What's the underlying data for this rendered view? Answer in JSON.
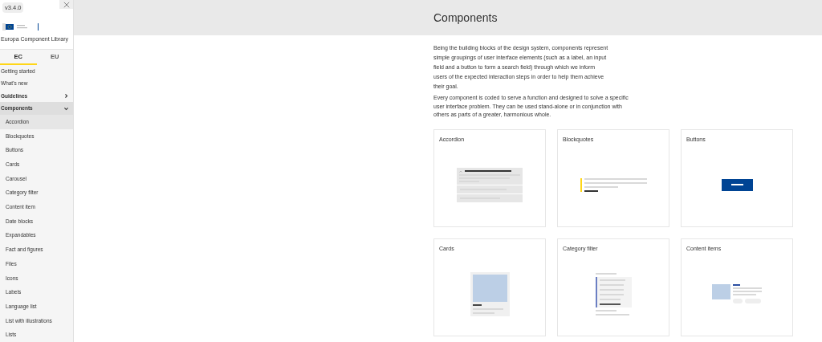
{
  "sidebar": {
    "version": "v3.4.0",
    "library_name": "Europa Component Library",
    "tabs": [
      {
        "label": "EC",
        "selected": true
      },
      {
        "label": "EU",
        "selected": false
      }
    ],
    "items": [
      {
        "label": "Getting started",
        "kind": "link"
      },
      {
        "label": "What's new",
        "kind": "link"
      },
      {
        "label": "Guidelines",
        "kind": "section",
        "expanded": false,
        "selected": false
      },
      {
        "label": "Components",
        "kind": "section",
        "expanded": true,
        "selected": true,
        "children": [
          {
            "label": "Accordion",
            "selected": true
          },
          {
            "label": "Blockquotes",
            "selected": false
          },
          {
            "label": "Buttons",
            "selected": false
          },
          {
            "label": "Cards",
            "selected": false
          },
          {
            "label": "Carousel",
            "selected": false
          },
          {
            "label": "Category filter",
            "selected": false
          },
          {
            "label": "Content item",
            "selected": false
          },
          {
            "label": "Date blocks",
            "selected": false
          },
          {
            "label": "Expandables",
            "selected": false
          },
          {
            "label": "Fact and figures",
            "selected": false
          },
          {
            "label": "Files",
            "selected": false
          },
          {
            "label": "Icons",
            "selected": false
          },
          {
            "label": "Labels",
            "selected": false
          },
          {
            "label": "Language list",
            "selected": false
          },
          {
            "label": "List with illustrations",
            "selected": false
          },
          {
            "label": "Lists",
            "selected": false
          }
        ]
      }
    ]
  },
  "page": {
    "title": "Components",
    "intro": "Being the building blocks of the design system, components represent simple groupings of user interface elements (such as a label, an input field and a button to form a search field) through which we inform users of the expected interaction steps in order to help them achieve their goal.",
    "description": "Every component is coded to serve a function and designed to solve a specific user interface problem. They can be used stand-alone or in conjunction with others as parts of a greater, harmonious whole.",
    "cards": [
      {
        "title": "Accordion",
        "kind": "accordion"
      },
      {
        "title": "Blockquotes",
        "kind": "blockquote"
      },
      {
        "title": "Buttons",
        "kind": "button"
      },
      {
        "title": "Cards",
        "kind": "card"
      },
      {
        "title": "Category filter",
        "kind": "filter"
      },
      {
        "title": "Content items",
        "kind": "content"
      }
    ]
  }
}
